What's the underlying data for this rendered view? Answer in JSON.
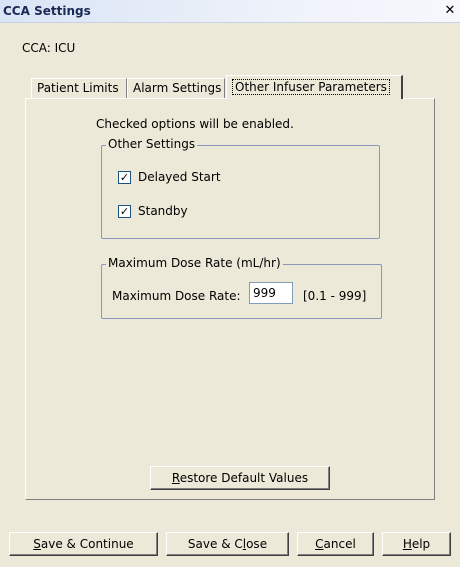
{
  "window": {
    "title": "CCA Settings",
    "close_glyph": "✕"
  },
  "context": {
    "label": "CCA: ICU"
  },
  "tabs": [
    {
      "label": "Patient Limits",
      "active": false
    },
    {
      "label": "Alarm Settings",
      "active": false
    },
    {
      "label": "Other Infuser Parameters",
      "active": true
    }
  ],
  "panel": {
    "hint": "Checked options will be enabled.",
    "other_settings": {
      "legend": "Other Settings",
      "options": [
        {
          "label": "Delayed Start",
          "checked": true,
          "check_glyph": "✓"
        },
        {
          "label": "Standby",
          "checked": true,
          "check_glyph": "✓"
        }
      ]
    },
    "max_dose_rate": {
      "legend": "Maximum Dose Rate (mL/hr)",
      "field_label": "Maximum Dose Rate:",
      "value": "999",
      "range": "[0.1 - 999]"
    },
    "restore_button": {
      "mnemonic": "R",
      "rest": "estore Default Values"
    }
  },
  "footer": {
    "save_continue": {
      "mnemonic": "S",
      "rest": "ave & Continue"
    },
    "save_close": {
      "prefix": "Save & C",
      "mnemonic": "l",
      "rest": "ose"
    },
    "cancel": {
      "mnemonic": "C",
      "rest": "ancel"
    },
    "help": {
      "mnemonic": "H",
      "rest": "elp"
    }
  }
}
